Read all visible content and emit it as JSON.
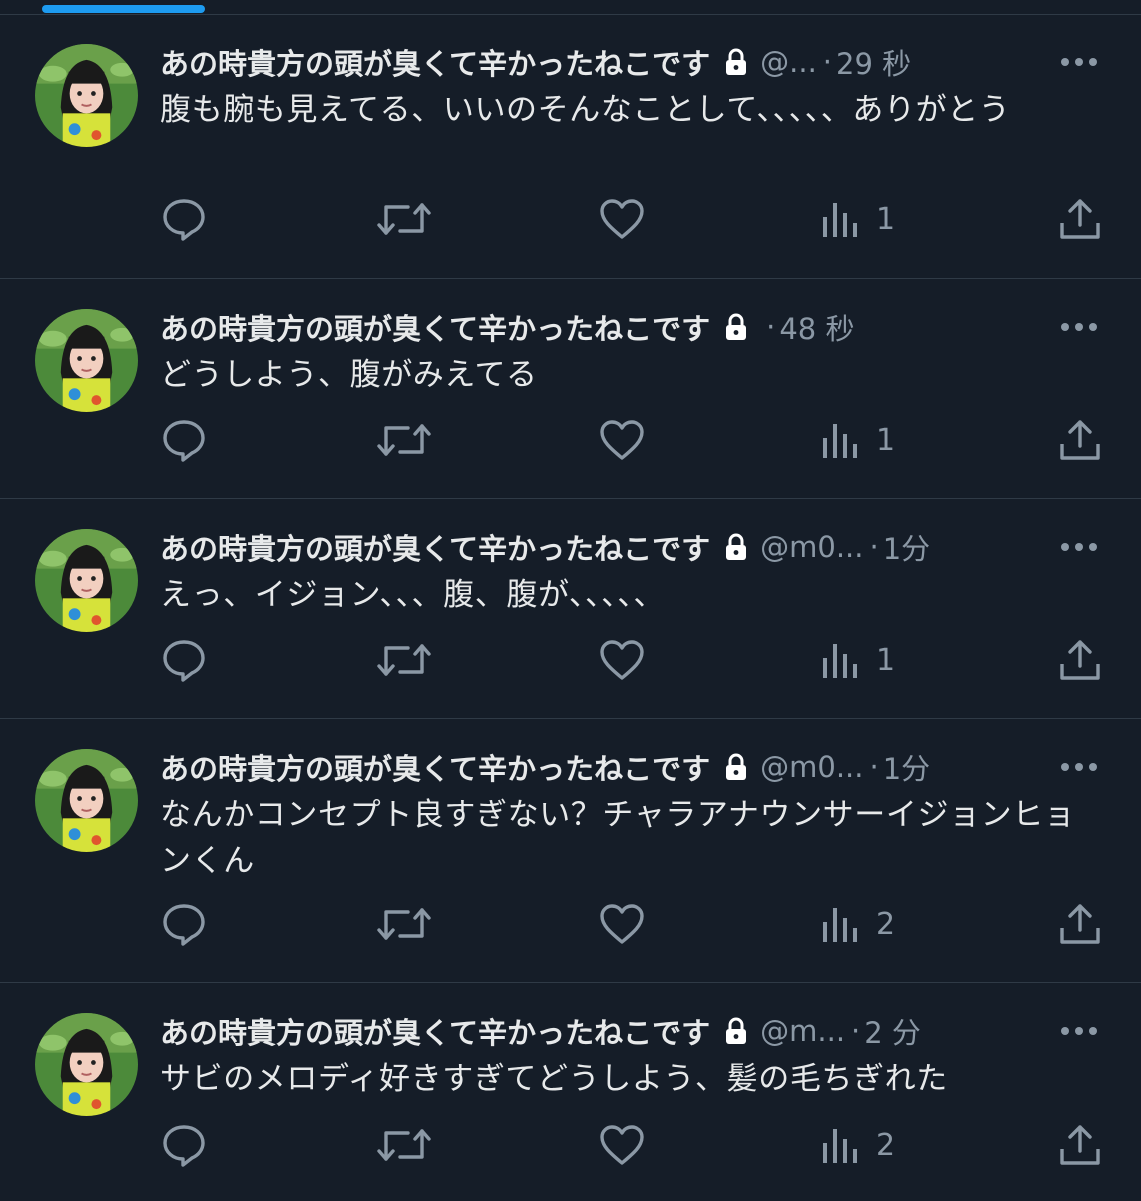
{
  "colors": {
    "background": "#151d28",
    "text_primary": "#e7e9ea",
    "text_secondary": "#8b98a5",
    "divider": "#2f3a46",
    "accent": "#1d9bf0"
  },
  "icons": {
    "lock": "lock-icon",
    "more": "more-icon",
    "reply": "reply-icon",
    "retweet": "retweet-icon",
    "like": "like-icon",
    "views": "views-icon",
    "share": "share-icon"
  },
  "tweets": [
    {
      "name": "あの時貴方の頭が臭くて辛かったねこです",
      "handle": "@...",
      "dot": "·",
      "time": "29 秒",
      "text": "腹も腕も見えてる、いいのそんなことして、、、、、ありがとう",
      "views": "1"
    },
    {
      "name": "あの時貴方の頭が臭くて辛かったねこです",
      "handle": "",
      "dot": "·",
      "time": "48 秒",
      "text": "どうしよう、腹がみえてる",
      "views": "1"
    },
    {
      "name": "あの時貴方の頭が臭くて辛かったねこです",
      "handle": "@m0...",
      "dot": "·",
      "time": "1分",
      "text": "えっ、イジョン、、、腹、腹が、、、、、",
      "views": "1"
    },
    {
      "name": "あの時貴方の頭が臭くて辛かったねこです",
      "handle": "@m0...",
      "dot": "·",
      "time": "1分",
      "text": "なんかコンセプト良すぎない？チャラアナウンサーイジョンヒョンくん",
      "views": "2"
    },
    {
      "name": "あの時貴方の頭が臭くて辛かったねこです",
      "handle": "@m...",
      "dot": "·",
      "time": "2 分",
      "text": "サビのメロディ好きすぎてどうしよう、髪の毛ちぎれた",
      "views": "2"
    }
  ]
}
